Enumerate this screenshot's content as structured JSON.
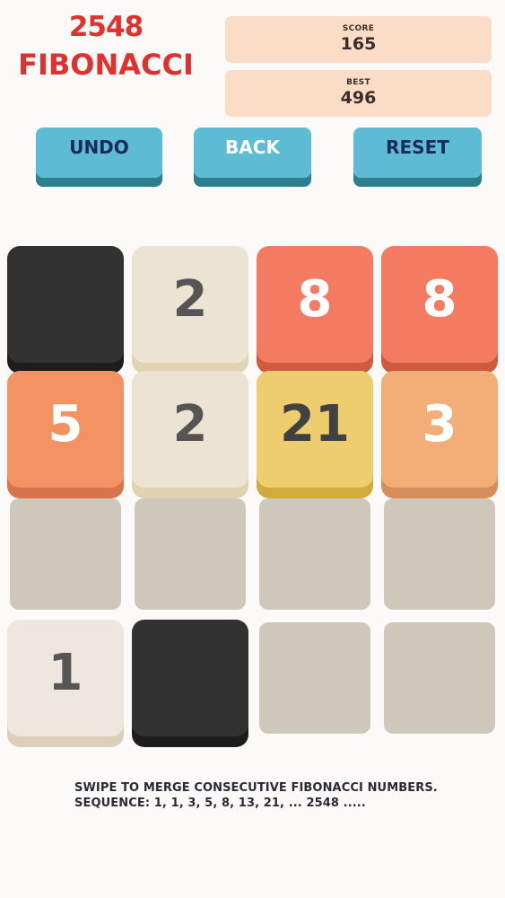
{
  "title": {
    "line1": "2548",
    "line2": "FIBONACCI"
  },
  "stats": {
    "score_label": "SCORE",
    "score_value": "165",
    "best_label": "BEST",
    "best_value": "496"
  },
  "buttons": {
    "undo": "UNDO",
    "back": "BACK",
    "reset": "RESET"
  },
  "board": {
    "rows": [
      [
        "",
        "2",
        "8",
        "8"
      ],
      [
        "5",
        "2",
        "21",
        "3"
      ],
      [
        "",
        "",
        "",
        ""
      ],
      [
        "1",
        "",
        "",
        ""
      ]
    ]
  },
  "instructions": {
    "line1": "SWIPE TO MERGE CONSECUTIVE FIBONACCI NUMBERS.",
    "line2": "SEQUENCE: 1, 1, 3, 5, 8, 13, 21, ... 2548 ....."
  },
  "colors": {
    "title": "#e0312e",
    "button": "#5dbcd4",
    "stat_box": "#fbdcc7"
  }
}
